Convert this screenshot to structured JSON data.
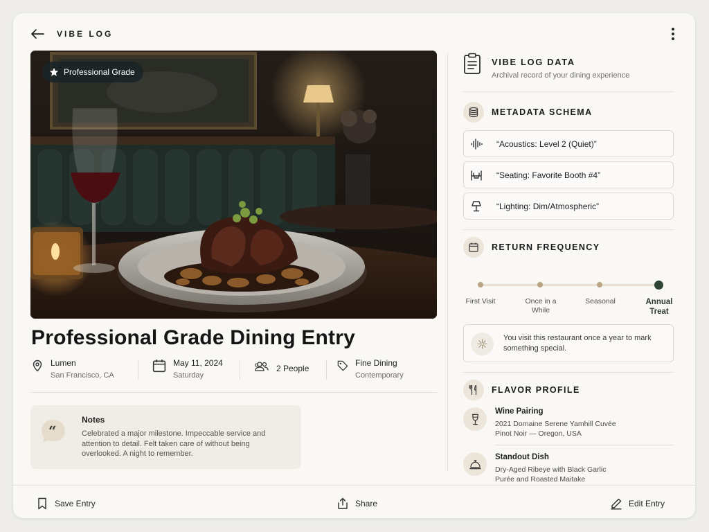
{
  "header": {
    "back_icon": "arrow-left-icon",
    "title": "VIBE LOG",
    "more_icon": "more-vertical-icon"
  },
  "photo": {
    "badge": "Professional Grade",
    "badge_icon": "star-icon",
    "alt": "Dry-aged ribeye on a plate with red wine in a dim restaurant"
  },
  "entry": {
    "title": "Professional Grade Dining Entry",
    "location": {
      "icon": "location-pin-icon",
      "name": "Lumen",
      "city": "San Francisco, CA"
    },
    "date": {
      "icon": "calendar-icon",
      "date": "May 11, 2024",
      "day": "Saturday"
    },
    "party": {
      "icon": "people-icon",
      "size": "2 People"
    },
    "category": {
      "icon": "tag-icon",
      "type": "Fine Dining",
      "style": "Contemporary"
    }
  },
  "notes": {
    "icon": "quote-bubble-icon",
    "label": "Notes",
    "body": "Celebrated a major milestone. Impeccable service and attention to detail. Felt taken care of without being overlooked. A night to remember."
  },
  "panel": {
    "icon": "clipboard-icon",
    "title": "VIBE LOG DATA",
    "subtitle": "Archival record of your dining experience"
  },
  "metadata": {
    "icon": "database-icon",
    "title": "METADATA SCHEMA",
    "items": [
      {
        "icon": "sound-wave-icon",
        "text": "“Acoustics: Level 2 (Quiet)”"
      },
      {
        "icon": "booth-seat-icon",
        "text": "“Seating: Favorite Booth #4”"
      },
      {
        "icon": "lamp-icon",
        "text": "“Lighting: Dim/Atmospheric”"
      }
    ]
  },
  "frequency": {
    "icon": "calendar-icon",
    "title": "RETURN FREQUENCY",
    "options": [
      {
        "label": "First Visit"
      },
      {
        "label": "Once in a While"
      },
      {
        "label": "Seasonal"
      },
      {
        "label": "Annual Treat"
      }
    ],
    "selected": "Annual Treat",
    "note_icon": "sparkle-icon",
    "note": "You visit this restaurant once a year to mark something special."
  },
  "flavor": {
    "icon": "fork-knife-icon",
    "title": "FLAVOR PROFILE",
    "wine": {
      "icon": "wine-glass-icon",
      "title": "Wine Pairing",
      "line1": "2021 Domaine Serene Yamhill Cuvée",
      "line2": "Pinot Noir — Oregon, USA"
    },
    "dish": {
      "icon": "cloche-icon",
      "title": "Standout Dish",
      "line1": "Dry-Aged Ribeye with Black Garlic",
      "line2": "Purée and Roasted Maitake"
    }
  },
  "footer": {
    "save": {
      "icon": "bookmark-icon",
      "label": "Save Entry"
    },
    "share": {
      "icon": "share-icon",
      "label": "Share"
    },
    "edit": {
      "icon": "pencil-icon",
      "label": "Edit Entry"
    }
  },
  "colors": {
    "background": "#eeede9",
    "card": "#f9f8f5",
    "accent_beige": "#ece5d9",
    "accent_green": "#2f4434",
    "muted_text": "#6e6b66"
  }
}
